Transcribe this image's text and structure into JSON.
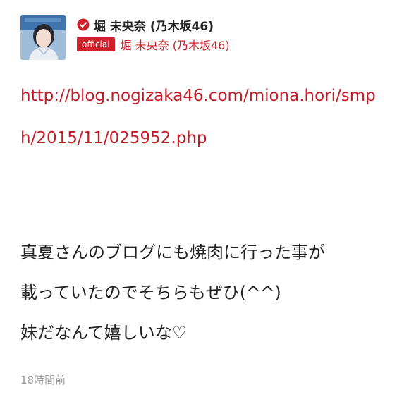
{
  "post": {
    "author": {
      "display_name": "堀 未央奈 (乃木坂46)",
      "handle": "堀 未央奈 (乃木坂46)",
      "badge": "official",
      "verified_icon": "verified-check-icon",
      "avatar": "profile-photo"
    },
    "link": "http://blog.nogizaka46.com/miona.hori/smph/2015/11/025952.php",
    "body_lines": [
      "真夏さんのブログにも焼肉に行った事が",
      "載っていたのでそちらもぜひ(^^)",
      "妹だなんて嬉しいな♡"
    ],
    "timestamp": "18時間前"
  },
  "colors": {
    "accent": "#d0222c",
    "link": "#c31c26",
    "text": "#222222",
    "muted": "#9a9a9a"
  }
}
